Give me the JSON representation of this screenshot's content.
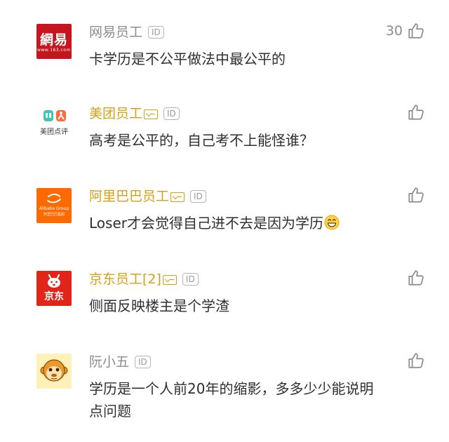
{
  "comments": [
    {
      "avatar": {
        "type": "netease",
        "logo_text": "網易",
        "logo_sub": "www.163.com"
      },
      "username": "网易员工",
      "username_color": "#8c8c8c",
      "verified": false,
      "id_badge": "ID",
      "text": "卡学历是不公平做法中最公平的",
      "likes": "30"
    },
    {
      "avatar": {
        "type": "meituan",
        "logo_text": "美团点评"
      },
      "username": "美团员工",
      "username_color": "#d4a017",
      "verified": true,
      "id_badge": "ID",
      "text": "高考是公平的，自己考不上能怪谁？",
      "likes": ""
    },
    {
      "avatar": {
        "type": "alibaba",
        "logo_text": "Alibaba Group",
        "logo_sub": "阿里巴巴集团"
      },
      "username": "阿里巴巴员工",
      "username_color": "#d4a017",
      "verified": true,
      "id_badge": "ID",
      "text": "Loser才会觉得自己进不去是因为学历",
      "emoji": "grinning-face-emoji",
      "likes": ""
    },
    {
      "avatar": {
        "type": "jd",
        "logo_text": "京东"
      },
      "username": "京东员工[2]",
      "username_color": "#d4a017",
      "verified": true,
      "id_badge": "ID",
      "text": "侧面反映楼主是个学渣",
      "likes": ""
    },
    {
      "avatar": {
        "type": "monkey"
      },
      "username": "阮小五",
      "username_color": "#8c8c8c",
      "verified": false,
      "id_badge": "ID",
      "text": "学历是一个人前20年的缩影，多多少少能说明点问题",
      "likes": ""
    }
  ],
  "icons": {
    "like": "thumbs-up-icon",
    "verified": "verified-badge-icon"
  },
  "colors": {
    "gray_name": "#8c8c8c",
    "gold_name": "#d4a017",
    "netease_red": "#c4161c",
    "alibaba_orange": "#ff6a00",
    "jd_red": "#e1251b"
  }
}
